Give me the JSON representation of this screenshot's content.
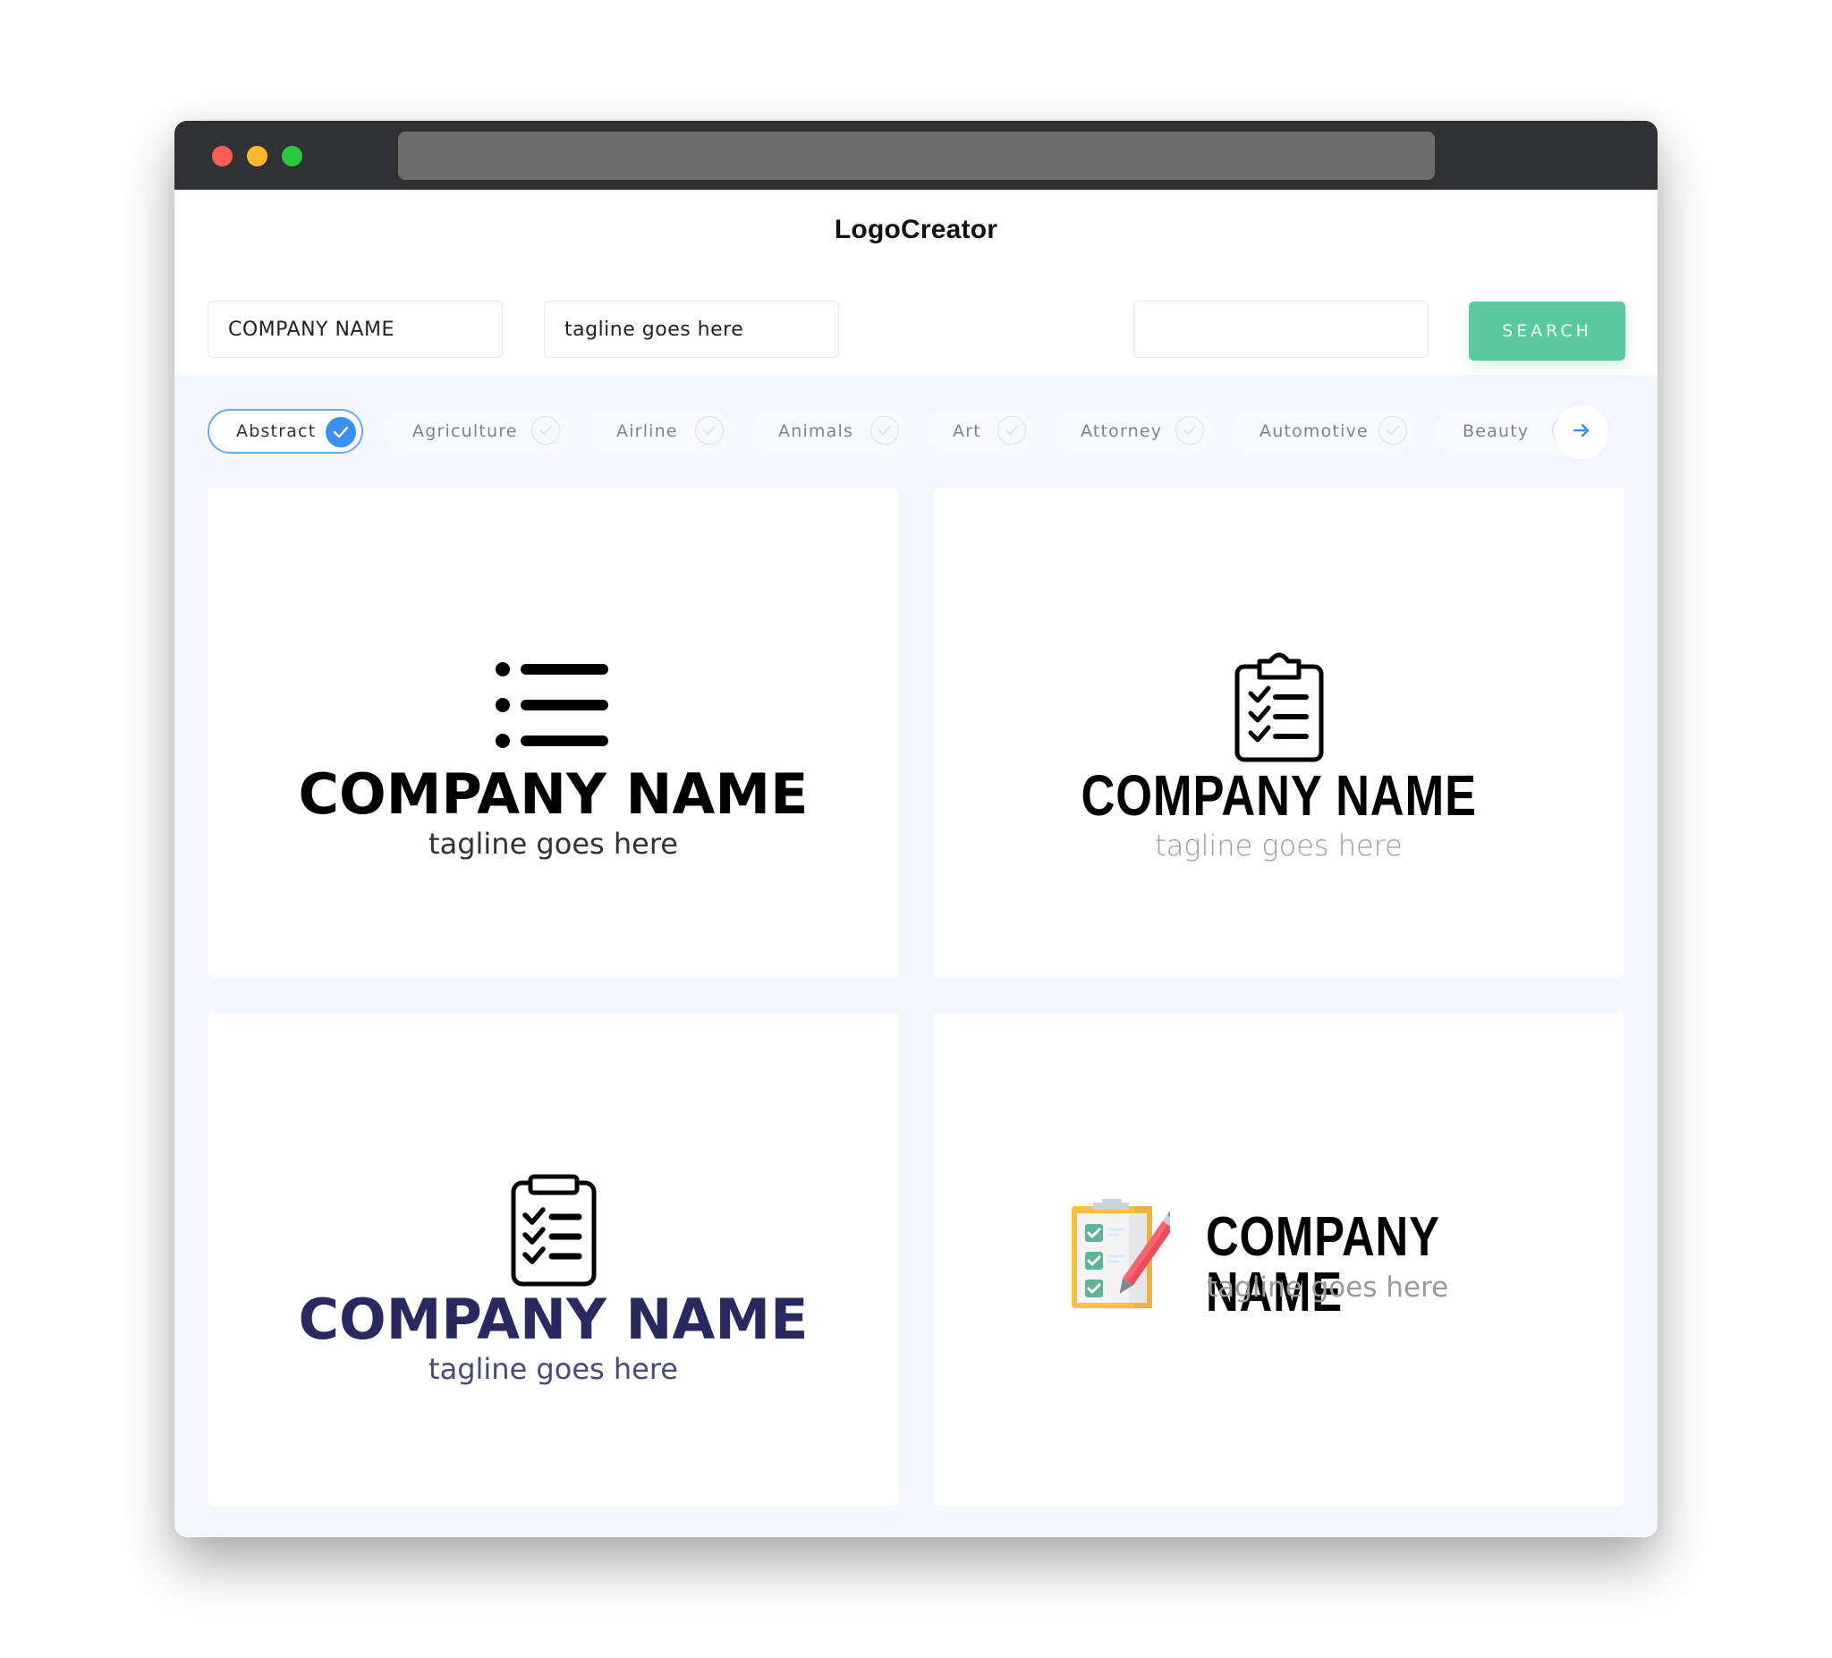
{
  "window": {
    "traffic_lights": [
      "close",
      "minimize",
      "maximize"
    ],
    "url": ""
  },
  "header": {
    "brand": "LogoCreator"
  },
  "search": {
    "company_name_value": "COMPANY NAME",
    "tagline_value": "tagline goes here",
    "extra_value": "",
    "button_label": "SEARCH"
  },
  "categories": {
    "items": [
      {
        "label": "Abstract",
        "selected": true
      },
      {
        "label": "Agriculture",
        "selected": false
      },
      {
        "label": "Airline",
        "selected": false
      },
      {
        "label": "Animals",
        "selected": false
      },
      {
        "label": "Art",
        "selected": false
      },
      {
        "label": "Attorney",
        "selected": false
      },
      {
        "label": "Automotive",
        "selected": false
      },
      {
        "label": "Beauty",
        "selected": false
      }
    ],
    "next_icon": "arrow-right-icon"
  },
  "colors": {
    "accent_green": "#5bc9a0",
    "accent_blue": "#3b8ff3",
    "navy": "#29285f",
    "titlebar": "#303133"
  },
  "logos": [
    {
      "icon": "list-icon",
      "company": "COMPANY NAME",
      "tagline": "tagline goes here",
      "color": "#000000",
      "tagline_color": "#333333"
    },
    {
      "icon": "clipboard-check-icon",
      "company": "COMPANY NAME",
      "tagline": "tagline goes here",
      "color": "#000000",
      "tagline_color": "#9a9a9a"
    },
    {
      "icon": "clipboard-check-icon",
      "company": "COMPANY NAME",
      "tagline": "tagline goes here",
      "color": "#29285f",
      "tagline_color": "#4a4a7a"
    },
    {
      "icon": "clipboard-pencil-icon",
      "company": "COMPANY NAME",
      "tagline": "tagline goes here",
      "color": "#000000",
      "tagline_color": "#9a9a9a"
    }
  ]
}
